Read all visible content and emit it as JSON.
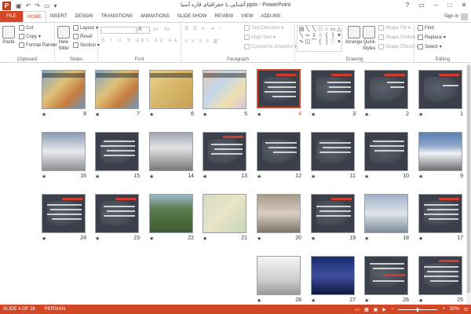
{
  "titlebar": {
    "app_icon": "P",
    "title": "آشنایی با جغرافیای قاره آسیا.pptx - PowerPoint",
    "qat": [
      "save-icon",
      "undo-icon",
      "redo-icon",
      "start-slideshow-icon",
      "customize-icon"
    ],
    "window_buttons": [
      "?",
      "▭",
      "–",
      "□",
      "✕"
    ]
  },
  "tabs": [
    "FILE",
    "HOME",
    "INSERT",
    "DESIGN",
    "TRANSITIONS",
    "ANIMATIONS",
    "SLIDE SHOW",
    "REVIEW",
    "VIEW",
    "ADD-INS"
  ],
  "active_tab": "HOME",
  "signin": "Sign in",
  "ribbon": {
    "clipboard": {
      "label": "Clipboard",
      "paste": "Paste",
      "cut": "Cut",
      "copy": "Copy",
      "format_painter": "Format Painter"
    },
    "slides": {
      "label": "Slides",
      "new_slide": "New",
      "new_slide2": "Slide",
      "layout": "Layout",
      "reset": "Reset",
      "section": "Section"
    },
    "font": {
      "label": "Font",
      "size": "0"
    },
    "paragraph": {
      "label": "Paragraph",
      "text_direction": "Text Direction",
      "align_text": "Align Text",
      "convert_smartart": "Convert to SmartArt"
    },
    "drawing": {
      "label": "Drawing",
      "arrange": "Arrange",
      "quick_styles": "Quick",
      "quick_styles2": "Styles",
      "shape_fill": "Shape Fill",
      "shape_outline": "Shape Outline",
      "shape_effects": "Shape Effects"
    },
    "editing": {
      "label": "Editing",
      "find": "Find",
      "replace": "Replace",
      "select": "Select"
    }
  },
  "slides": [
    {
      "n": "1",
      "star": "★"
    },
    {
      "n": "2",
      "star": "★"
    },
    {
      "n": "3",
      "star": "★"
    },
    {
      "n": "4",
      "star": "★"
    },
    {
      "n": "5",
      "star": "★"
    },
    {
      "n": "6",
      "star": "★"
    },
    {
      "n": "7",
      "star": "★"
    },
    {
      "n": "8",
      "star": "★"
    },
    {
      "n": "9",
      "star": "★"
    },
    {
      "n": "10",
      "star": "★"
    },
    {
      "n": "11",
      "star": "★"
    },
    {
      "n": "12",
      "star": "★"
    },
    {
      "n": "13",
      "star": "★"
    },
    {
      "n": "14",
      "star": "★"
    },
    {
      "n": "15",
      "star": "★"
    },
    {
      "n": "16",
      "star": "★"
    },
    {
      "n": "17",
      "star": "★"
    },
    {
      "n": "18",
      "star": "★"
    },
    {
      "n": "19",
      "star": "★"
    },
    {
      "n": "20",
      "star": "★"
    },
    {
      "n": "21",
      "star": "★"
    },
    {
      "n": "22",
      "star": "★"
    },
    {
      "n": "23",
      "star": "★"
    },
    {
      "n": "24",
      "star": "★"
    },
    {
      "n": "25",
      "star": "★"
    },
    {
      "n": "26",
      "star": "★"
    },
    {
      "n": "27",
      "star": "★"
    },
    {
      "n": "28",
      "star": "★"
    }
  ],
  "selected_slide": "4",
  "status": {
    "slide_of": "SLIDE 4 OF 28",
    "language": "PERSIAN",
    "zoom": "50%"
  },
  "colors": {
    "accent": "#d24726"
  }
}
